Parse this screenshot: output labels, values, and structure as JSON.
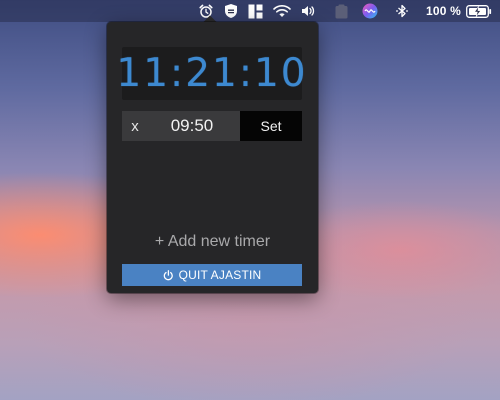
{
  "menubar": {
    "icons": [
      "alarm-clock-icon",
      "shield-icon",
      "layout-grid-icon",
      "wifi-icon",
      "volume-icon",
      "clipboard-icon",
      "siri-icon",
      "bluetooth-icon",
      "battery-charging-icon"
    ],
    "battery_percent": "100 %"
  },
  "app": {
    "name": "Ajastin",
    "clock_time": "11:21:10",
    "timers": [
      {
        "remove_label": "x",
        "value": "09:50",
        "set_label": "Set"
      }
    ],
    "add_timer_label": "+ Add new timer",
    "quit_label": "QUIT AJASTIN",
    "colors": {
      "clock_digits": "#3d89d0",
      "quit_button": "#4a82c3",
      "panel_background": "#262628"
    }
  }
}
